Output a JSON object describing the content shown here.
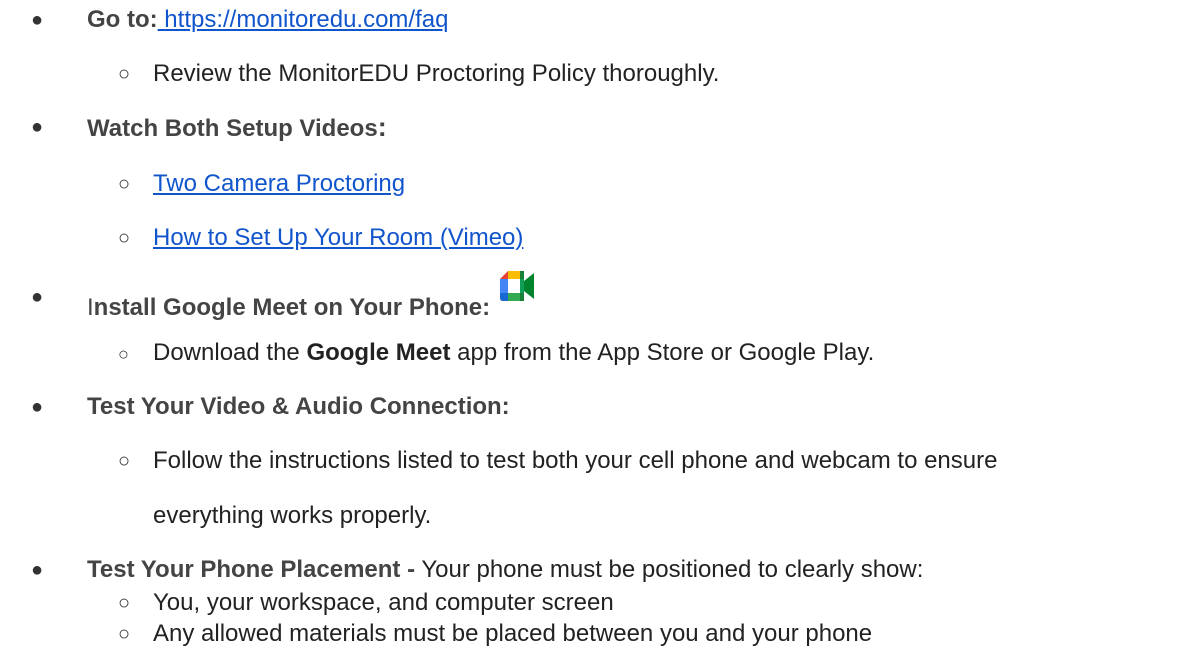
{
  "items": [
    {
      "label": "Go to:",
      "link_text": " https://monitoredu.com/faq",
      "sub": [
        "Review the MonitorEDU Proctoring Policy thoroughly."
      ]
    },
    {
      "label": "Watch Both Setup Videos",
      "label_colon": ":",
      "sub_links": [
        "Two Camera Proctoring",
        "How to Set Up Your Room (Vimeo)"
      ]
    },
    {
      "label_first": "I",
      "label_rest": "nstall Google Meet on Your Phone:",
      "icon": "google-meet-icon",
      "sub": {
        "before": "Download the ",
        "bold": "Google Meet",
        "after": " app from the App Store or Google Play."
      }
    },
    {
      "label": "Test Your Video & Audio Connection:",
      "sub_line1": "Follow the instructions listed to test both your cell phone and webcam to ensure",
      "sub_line2": "everything works properly."
    },
    {
      "label": "Test Your Phone Placement -",
      "text": " Your phone must be positioned to clearly show:",
      "sub": [
        "You, your workspace, and computer screen",
        "Any allowed materials must be placed between you and your phone"
      ]
    }
  ],
  "bullet_main": "●",
  "bullet_sub": "○",
  "colors": {
    "link": "#1155cc",
    "text": "#222222",
    "heading": "#444444"
  }
}
